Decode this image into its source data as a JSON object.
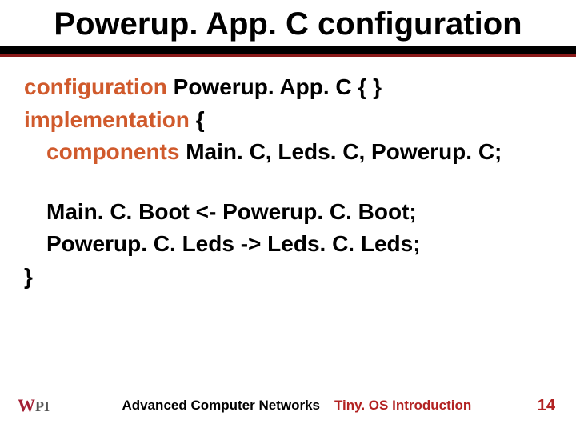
{
  "header": {
    "title": "Powerup. App. C configuration"
  },
  "code": {
    "line1_kw": "configuration ",
    "line1_rest": "Powerup. App. C { }",
    "line2_kw": "implementation ",
    "line2_rest": "{",
    "line3_kw": "  components ",
    "line3_rest": "Main. C, Leds. C, Powerup. C;",
    "line4": "  Main. C. Boot  <- Powerup. C. Boot;",
    "line5": "  Powerup. C. Leds -> Leds. C. Leds;",
    "line6": "}"
  },
  "footer": {
    "course": "Advanced Computer Networks",
    "topic": "Tiny. OS Introduction",
    "page": "14",
    "logo_text": "WPI"
  }
}
